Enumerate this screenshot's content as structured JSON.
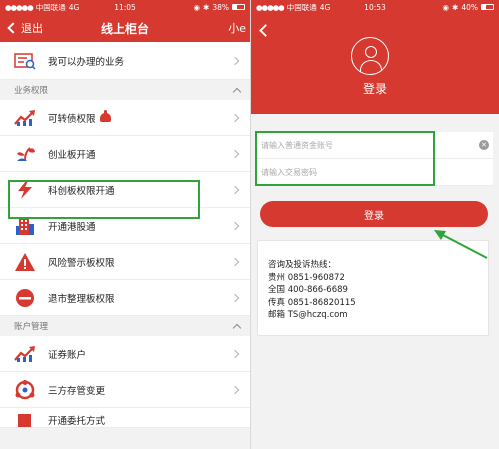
{
  "left": {
    "status": {
      "carrier": "中国联通",
      "network": "4G",
      "time": "11:05",
      "battery": "38%",
      "battery_level": 0.38
    },
    "nav": {
      "back_label": "退出",
      "title": "线上柜台",
      "right_label": "小e"
    },
    "rows": {
      "business": "我可以办理的业务",
      "section_quota": "业务权限",
      "convertible": "可转债权限",
      "growth": "创业板开通",
      "star": "科创板权限开通",
      "hk": "开通港股通",
      "risk": "风险警示板权限",
      "delist": "退市整理板权限",
      "section_account": "账户管理",
      "securities": "证券账户",
      "custody": "三方存管变更",
      "partial": "开通委托方式"
    }
  },
  "right": {
    "status": {
      "carrier": "中国联通",
      "network": "4G",
      "time": "10:53",
      "battery": "40%",
      "battery_level": 0.4
    },
    "title": "登录",
    "account_placeholder": "请输入普通资金账号",
    "password_placeholder": "请输入交易密码",
    "login_button": "登录",
    "contact": {
      "heading": "咨询及投诉热线：",
      "guizhou": "贵州 0851-960872",
      "national": "全国 400-866-6689",
      "fax": "传真 0851-86820115",
      "email": "邮箱 TS@hczq.com"
    }
  },
  "colors": {
    "brand_red": "#d6392f",
    "highlight_green": "#2ea43a"
  }
}
